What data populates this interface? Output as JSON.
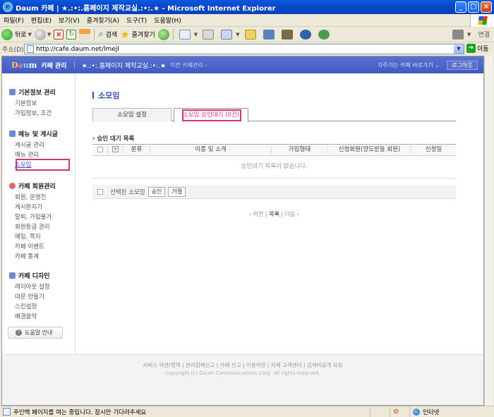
{
  "window": {
    "title": "Daum 카페 | ★.:•:.홈페이지 제작교실.:•:.★ - Microsoft Internet Explorer",
    "min": "_",
    "max": "□",
    "close": "×"
  },
  "menubar": [
    "파일(F)",
    "편집(E)",
    "보기(V)",
    "즐겨찾기(A)",
    "도구(T)",
    "도움말(H)"
  ],
  "toolbar": {
    "back": "뒤로",
    "search": "검색",
    "favorites": "즐겨찾기",
    "links": "연결"
  },
  "address": {
    "label": "주소(D)",
    "url": "http://cafe.daum.net/lmejl",
    "go": "이동"
  },
  "header": {
    "logo": [
      "D",
      "a",
      "u",
      "m"
    ],
    "manager_title": "카페 관리",
    "cafe_name": "★.:•:.홈페이지 제작교실.:•:.★",
    "prev_link": "이전 카페관리 ›",
    "goto_cafe": "자주가는 카페 바로가기 ⌄",
    "logout": "로그아웃"
  },
  "nav": {
    "groups": [
      {
        "title": "기본정보 관리",
        "items": [
          "기본정보",
          "가입정보, 조건"
        ]
      },
      {
        "title": "메뉴 및 게시글",
        "items": [
          "게시글 관리",
          "메뉴 관리",
          "소모임"
        ]
      },
      {
        "title": "카페 회원관리",
        "items": [
          "회원, 운영진",
          "게시판지기",
          "탈퇴, 가입불가",
          "회원등급 관리",
          "메일, 쪽지",
          "카페 이벤트",
          "카페 통계"
        ]
      },
      {
        "title": "카페 디자인",
        "items": [
          "레이아웃 설정",
          "대문 만들기",
          "스킨설정",
          "배경음악"
        ]
      }
    ],
    "help": "도움말 안내"
  },
  "main": {
    "page_title": "소모임",
    "tabs": [
      "소모임 설정",
      "소모임 승인대기 (0건)"
    ],
    "list_title": "› 승인 대기 목록",
    "columns": [
      "분류",
      "이름 및 소개",
      "가입형태",
      "신청회원(양도받을 회원)",
      "신청일"
    ],
    "empty_message": "승인대기 목록이 없습니다.",
    "selected_label": "선택된 소모임",
    "approve": "승인",
    "reject": "거절",
    "pager": {
      "prev": "‹ 이전",
      "list": "목록",
      "next": "다음 ›"
    }
  },
  "footer": {
    "links": "서비스 약관/정책 | 권리침해신고 | 카페 신고 | 이용약관 | 카페 고객센터 | 검색비공개 요청",
    "copyright": "Copyright (c) Daum Communications Corp. All rights reserved."
  },
  "status": {
    "text": "주인백 페이지를 여는 중입니다. 잠시만 기다려주세요",
    "zone": "인터넷"
  }
}
